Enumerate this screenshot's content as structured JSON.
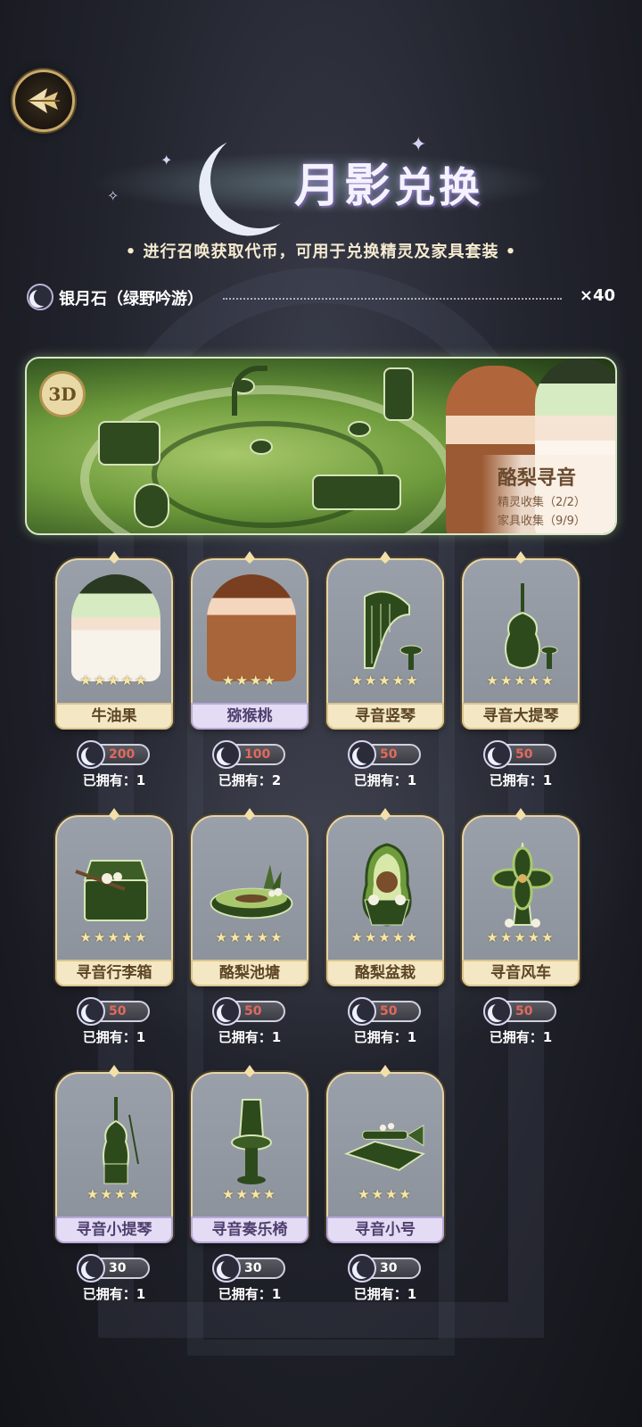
{
  "header": {
    "title_main": "月影",
    "title_sub": "兑换",
    "subtitle": "• 进行召唤获取代币，可用于兑换精灵及家具套装 •"
  },
  "currency": {
    "name": "银月石（绿野吟游）",
    "count": "×40",
    "icon": "moon-crescent-icon"
  },
  "banner": {
    "badge": "3D",
    "set_name": "酪梨寻音",
    "spirit_collect": "精灵收集（2/2）",
    "furniture_collect": "家具收集（9/9）"
  },
  "items": [
    {
      "name": "牛油果",
      "price": "200",
      "owned": "已拥有：1",
      "stars": "★★★★★",
      "plate": "gold",
      "affordable": false
    },
    {
      "name": "猕猴桃",
      "price": "100",
      "owned": "已拥有：2",
      "stars": "★★★★",
      "plate": "purple",
      "affordable": false
    },
    {
      "name": "寻音竖琴",
      "price": "50",
      "owned": "已拥有：1",
      "stars": "★★★★★",
      "plate": "gold",
      "affordable": false
    },
    {
      "name": "寻音大提琴",
      "price": "50",
      "owned": "已拥有：1",
      "stars": "★★★★★",
      "plate": "gold",
      "affordable": false
    },
    {
      "name": "寻音行李箱",
      "price": "50",
      "owned": "已拥有：1",
      "stars": "★★★★★",
      "plate": "gold",
      "affordable": false
    },
    {
      "name": "酪梨池塘",
      "price": "50",
      "owned": "已拥有：1",
      "stars": "★★★★★",
      "plate": "gold",
      "affordable": false
    },
    {
      "name": "酪梨盆栽",
      "price": "50",
      "owned": "已拥有：1",
      "stars": "★★★★★",
      "plate": "gold",
      "affordable": false
    },
    {
      "name": "寻音风车",
      "price": "50",
      "owned": "已拥有：1",
      "stars": "★★★★★",
      "plate": "gold",
      "affordable": false
    },
    {
      "name": "寻音小提琴",
      "price": "30",
      "owned": "已拥有：1",
      "stars": "★★★★",
      "plate": "purple",
      "affordable": true
    },
    {
      "name": "寻音奏乐椅",
      "price": "30",
      "owned": "已拥有：1",
      "stars": "★★★★",
      "plate": "purple",
      "affordable": true
    },
    {
      "name": "寻音小号",
      "price": "30",
      "owned": "已拥有：1",
      "stars": "★★★★",
      "plate": "purple",
      "affordable": true
    }
  ]
}
